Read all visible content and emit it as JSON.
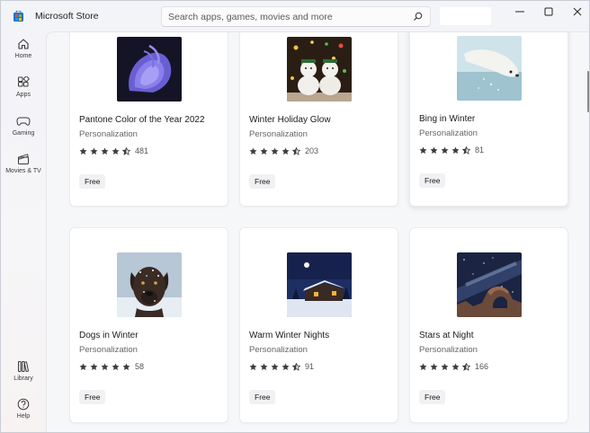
{
  "app": {
    "title": "Microsoft Store"
  },
  "search": {
    "placeholder": "Search apps, games, movies and more"
  },
  "nav": {
    "items": [
      {
        "label": "Home",
        "icon": "home-icon"
      },
      {
        "label": "Apps",
        "icon": "apps-icon"
      },
      {
        "label": "Gaming",
        "icon": "gaming-icon"
      },
      {
        "label": "Movies & TV",
        "icon": "movies-tv-icon"
      },
      {
        "label": "Library",
        "icon": "library-icon"
      },
      {
        "label": "Help",
        "icon": "help-icon"
      }
    ]
  },
  "cards": [
    {
      "title": "Pantone Color of the Year 2022",
      "category": "Personalization",
      "rating": 4.5,
      "count": "481",
      "price": "Free"
    },
    {
      "title": "Winter Holiday Glow",
      "category": "Personalization",
      "rating": 4.5,
      "count": "203",
      "price": "Free"
    },
    {
      "title": "Bing in Winter",
      "category": "Personalization",
      "rating": 4.5,
      "count": "81",
      "price": "Free"
    },
    {
      "title": "Dogs in Winter",
      "category": "Personalization",
      "rating": 5,
      "count": "58",
      "price": "Free"
    },
    {
      "title": "Warm Winter Nights",
      "category": "Personalization",
      "rating": 4.5,
      "count": "91",
      "price": "Free"
    },
    {
      "title": "Stars at Night",
      "category": "Personalization",
      "rating": 4.5,
      "count": "166",
      "price": "Free"
    }
  ],
  "colors": {
    "star": "#3d3d3d",
    "accent": "#0067c0"
  }
}
